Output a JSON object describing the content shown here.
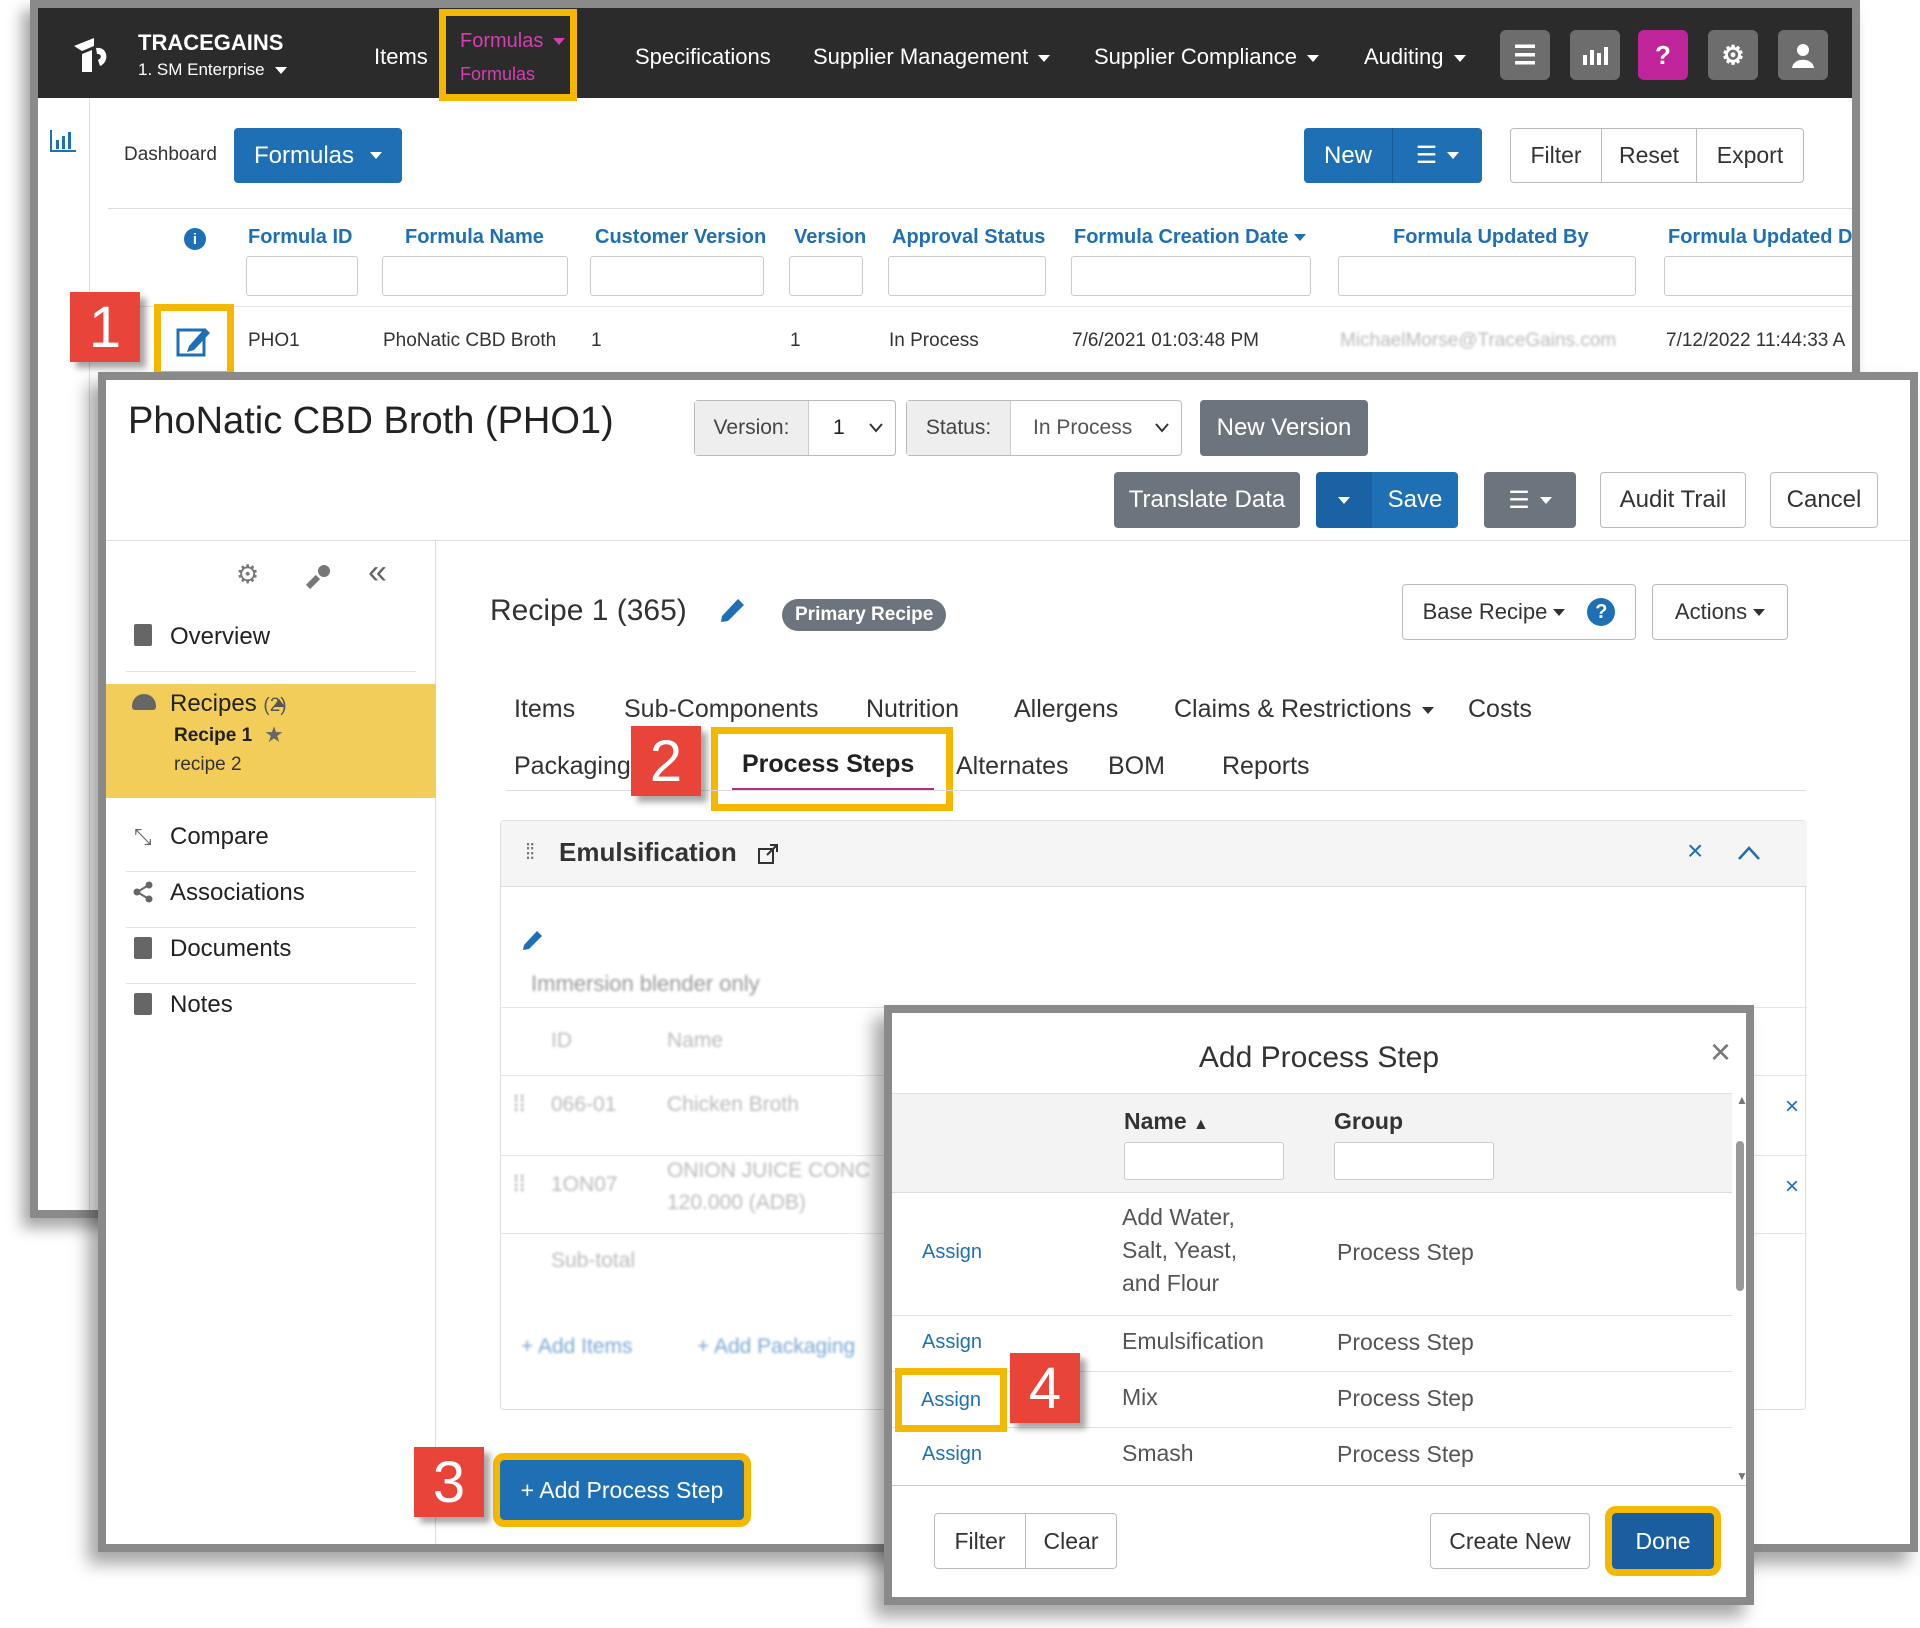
{
  "nav": {
    "brand": "TRACEGAINS",
    "enterprise": "1. SM Enterprise",
    "items": "Items",
    "formulas": "Formulas",
    "formulas_sub": "Formulas",
    "specifications": "Specifications",
    "supplier_management": "Supplier Management",
    "supplier_compliance": "Supplier Compliance",
    "auditing": "Auditing",
    "help_glyph": "?"
  },
  "list": {
    "dashboard": "Dashboard",
    "module_button": "Formulas",
    "new_button": "New",
    "filter": "Filter",
    "reset": "Reset",
    "export": "Export",
    "columns": [
      "Formula ID",
      "Formula Name",
      "Customer Version",
      "Version",
      "Approval Status",
      "Formula Creation Date",
      "Formula Updated By",
      "Formula Updated D"
    ],
    "row": {
      "formula_id": "PHO1",
      "formula_name": "PhoNatic CBD Broth",
      "customer_version": "1",
      "version": "1",
      "approval_status": "In Process",
      "creation_date": "7/6/2021 01:03:48 PM",
      "updated_by": "MichaelMorse@TraceGains.com",
      "updated_date": "7/12/2022 11:44:33 A"
    }
  },
  "editor": {
    "title": "PhoNatic CBD Broth (PHO1)",
    "version_label": "Version:",
    "version_value": "1",
    "status_label": "Status:",
    "status_value": "In Process",
    "new_version": "New Version",
    "translate": "Translate Data",
    "save": "Save",
    "audit_trail": "Audit Trail",
    "cancel": "Cancel",
    "sidebar": {
      "overview": "Overview",
      "recipes": "Recipes",
      "recipes_count": "(2)",
      "recipe1": "Recipe 1",
      "recipe2": "recipe 2",
      "compare": "Compare",
      "associations": "Associations",
      "documents": "Documents",
      "notes": "Notes"
    },
    "recipe_title": "Recipe 1 (365)",
    "primary_badge": "Primary Recipe",
    "base_recipe": "Base Recipe",
    "actions": "Actions",
    "tabs_row1": [
      "Items",
      "Sub-Components",
      "Nutrition",
      "Allergens",
      "Claims & Restrictions",
      "Costs"
    ],
    "tabs_row2": [
      "Packaging",
      "Process Steps",
      "Alternates",
      "BOM",
      "Reports"
    ],
    "step": {
      "title": "Emulsification",
      "note": "Immersion blender only",
      "col_id": "ID",
      "col_name": "Name",
      "row1_id": "066-01",
      "row1_name": "Chicken Broth",
      "row2_id": "1ON07",
      "row2_name": "ONION JUICE CONC",
      "row2_qty": "120.000 (ADB)",
      "subtotal": "Sub-total",
      "add_items": "+ Add Items",
      "add_packaging": "+ Add Packaging"
    },
    "add_process_step": "+ Add Process Step"
  },
  "modal": {
    "title": "Add Process Step",
    "col_name": "Name",
    "col_group": "Group",
    "rows": [
      {
        "action": "Assign",
        "name": "Add Water, Salt, Yeast, and Flour",
        "group": "Process Step"
      },
      {
        "action": "Assign",
        "name": "Emulsification",
        "group": "Process Step"
      },
      {
        "action": "Assign",
        "name": "Mix",
        "group": "Process Step"
      },
      {
        "action": "Assign",
        "name": "Smash",
        "group": "Process Step"
      }
    ],
    "filter": "Filter",
    "clear": "Clear",
    "create_new": "Create New",
    "done": "Done"
  },
  "callouts": [
    "1",
    "2",
    "3",
    "4"
  ],
  "colors": {
    "accent": "#1f6fb5",
    "highlight": "#f5b800",
    "callout": "#e8443a",
    "nav_bg": "#2b2b2b",
    "help": "#c0249b"
  }
}
